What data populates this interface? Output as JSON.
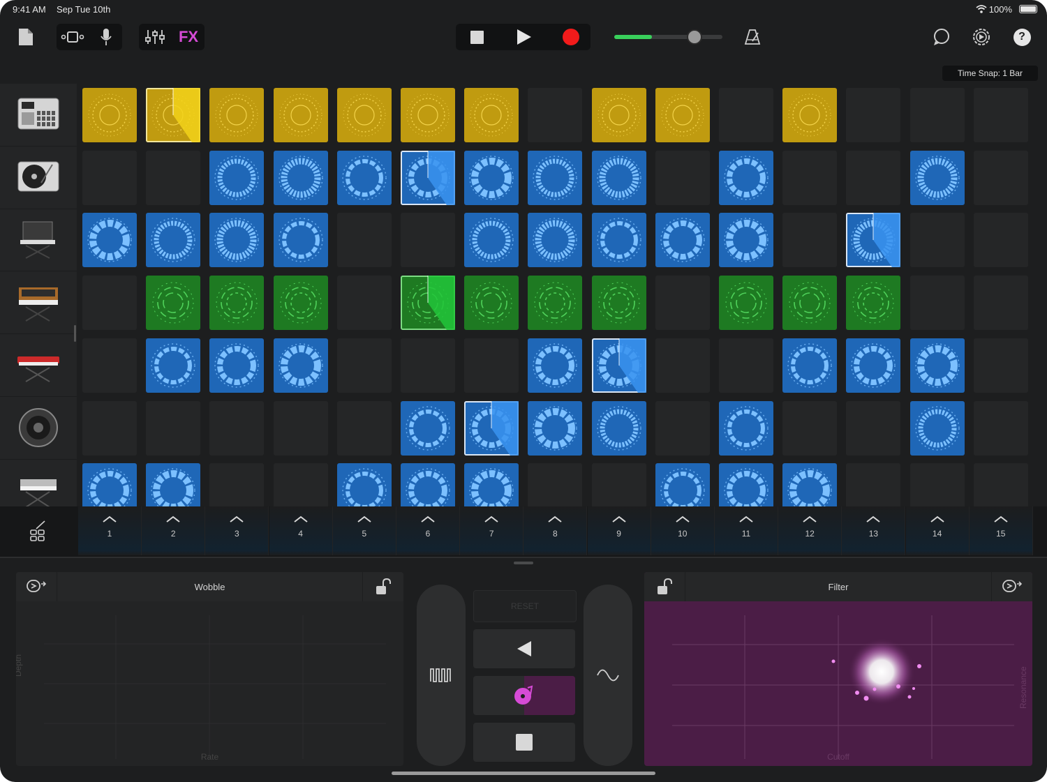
{
  "status_bar": {
    "time": "9:41 AM",
    "date": "Sep Tue 10th",
    "battery": "100%"
  },
  "toolbar": {
    "fx_label": "FX",
    "volume_level": 0.78,
    "icons": [
      "document-icon",
      "view-toggle-icon",
      "microphone-icon",
      "mixer-icon",
      "fx-button",
      "stop-icon",
      "play-icon",
      "record-icon",
      "metronome-icon",
      "loop-browser-icon",
      "settings-icon",
      "help-icon"
    ]
  },
  "time_snap": "Time Snap: 1 Bar",
  "instruments": [
    "drum-machine",
    "turntable",
    "synth-stand",
    "retro-synth",
    "red-keyboard",
    "speaker",
    "keyboard"
  ],
  "grid": {
    "rows": [
      [
        "Y",
        "Y",
        "Y",
        "Y",
        "Y",
        "Y",
        "Y",
        "",
        "Y",
        "Y",
        "",
        "Y",
        "",
        "",
        ""
      ],
      [
        "",
        "",
        "B",
        "B",
        "B",
        "B",
        "B",
        "B",
        "B",
        "",
        "B",
        "",
        "",
        "B",
        ""
      ],
      [
        "B",
        "B",
        "B",
        "B",
        "",
        "",
        "B",
        "B",
        "B",
        "B",
        "B",
        "",
        "B",
        "",
        ""
      ],
      [
        "",
        "G",
        "G",
        "G",
        "",
        "G",
        "G",
        "G",
        "G",
        "",
        "G",
        "G",
        "G",
        "",
        ""
      ],
      [
        "",
        "B",
        "B",
        "B",
        "",
        "",
        "",
        "B",
        "B",
        "",
        "",
        "B",
        "B",
        "B",
        ""
      ],
      [
        "",
        "",
        "",
        "",
        "",
        "B",
        "B",
        "B",
        "B",
        "",
        "B",
        "",
        "",
        "B",
        ""
      ],
      [
        "B",
        "B",
        "",
        "",
        "B",
        "B",
        "B",
        "",
        "",
        "B",
        "B",
        "B",
        "",
        "",
        ""
      ]
    ],
    "playing": [
      [
        0,
        1
      ],
      [
        1,
        5
      ],
      [
        2,
        12
      ],
      [
        3,
        5
      ],
      [
        4,
        8
      ],
      [
        5,
        6
      ]
    ],
    "colors": {
      "Y": "#c09b10",
      "B": "#1f67b7",
      "G": "#1e7a22"
    }
  },
  "triggers": [
    "1",
    "2",
    "3",
    "4",
    "5",
    "6",
    "7",
    "8",
    "9",
    "10",
    "11",
    "12",
    "13",
    "14",
    "15"
  ],
  "left_pad": {
    "title": "Wobble",
    "x_label": "Rate",
    "y_label": "Depth"
  },
  "right_pad": {
    "title": "Filter",
    "x_label": "Cutoff",
    "y_label": "Resonance",
    "color": "#4b1d46"
  },
  "center": {
    "reset_label": "RESET"
  }
}
